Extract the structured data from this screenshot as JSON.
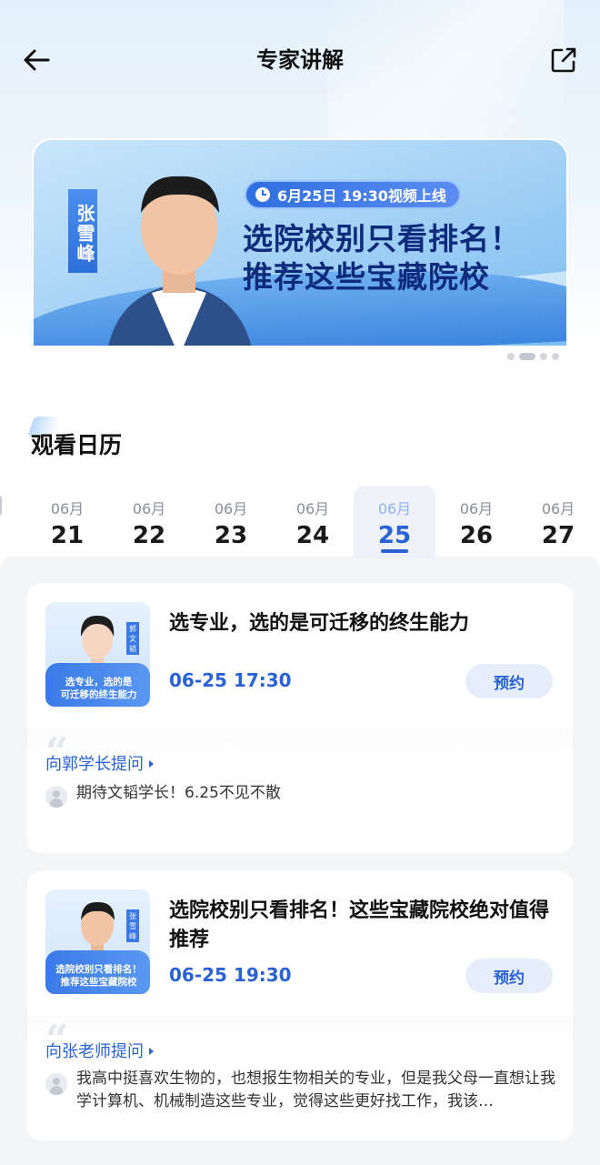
{
  "header": {
    "title": "专家讲解",
    "back_icon": "arrow-left-icon",
    "share_icon": "share-external-icon"
  },
  "banner": {
    "time_badge": "6月25日 19:30视频上线",
    "headline_line1": "选院校别只看排名！",
    "headline_line2": "推荐这些宝藏院校",
    "name_plate": "张雪峰",
    "dots": 4,
    "active_dot": 1
  },
  "calendar": {
    "title": "观看日历",
    "dates": [
      {
        "month": "06月",
        "day": "21"
      },
      {
        "month": "06月",
        "day": "22"
      },
      {
        "month": "06月",
        "day": "23"
      },
      {
        "month": "06月",
        "day": "24"
      },
      {
        "month": "06月",
        "day": "25"
      },
      {
        "month": "06月",
        "day": "26"
      },
      {
        "month": "06月",
        "day": "27"
      }
    ],
    "selected_day": "25"
  },
  "cards": [
    {
      "title": "选专业，选的是可迁移的终生能力",
      "time": "06-25 17:30",
      "button": "预约",
      "thumb_caption_line1": "选专业，选的是",
      "thumb_caption_line2": "可迁移的终生能力",
      "thumb_tag": "郭文韬",
      "ask_label": "向郭学长提问",
      "question": "期待文韬学长！6.25不见不散"
    },
    {
      "title": "选院校别只看排名！这些宝藏院校绝对值得推荐",
      "time": "06-25 19:30",
      "button": "预约",
      "thumb_caption_line1": "选院校别只看排名！",
      "thumb_caption_line2": "推荐这些宝藏院校",
      "thumb_tag": "张雪峰",
      "ask_label": "向张老师提问",
      "question": "我高中挺喜欢生物的，也想报生物相关的专业，但是我父母一直想让我学计算机、机械制造这些专业，觉得这些更好找工作，我该…"
    }
  ],
  "colors": {
    "accent": "#2a62d6",
    "banner_headline": "#0e2a7a",
    "button_bg": "#e6eefc"
  }
}
